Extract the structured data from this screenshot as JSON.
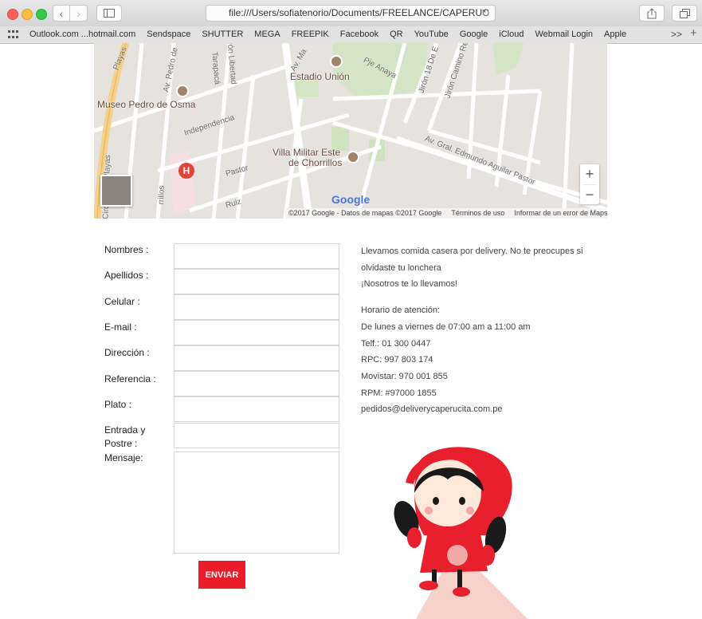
{
  "browser": {
    "address": "file:///Users/sofiatenorio/Documents/FREELANCE/CAPERUC",
    "bookmarks": [
      "Outlook.com ...hotmail.com",
      "Sendspace",
      "SHUTTER",
      "MEGA",
      "FREEPIK",
      "Facebook",
      "QR",
      "YouTube",
      "Google",
      "iCloud",
      "Webmail Login",
      "Apple"
    ],
    "more": ">>"
  },
  "map": {
    "places": {
      "museo": "Museo Pedro de Osma",
      "estadio": "Estadio Unión",
      "villa_line1": "Villa Militar Este",
      "villa_line2": "de Chorrillos"
    },
    "streets": {
      "independencia": "Independencia",
      "pastor": "Pastor",
      "ruiz": "Ruiz",
      "anaya": "Pje Anaya",
      "edmundo": "Av. Gral. Edmundo Aguilar Pastor",
      "camino": "Jirón Camino Re",
      "jiron18": "Jirón 18 De E",
      "libertad": "Jirón Libertad",
      "tarapaca": "Tarapacá",
      "pedro": "Av. Pedro de",
      "playas": "Playas",
      "circuito": "Circuito de Playas",
      "rillos": "rrillos",
      "av_ma": "Av. Ma"
    },
    "google": "Google",
    "footer": {
      "copyright": "©2017 Google - Datos de mapas ©2017 Google",
      "terms": "Términos de uso",
      "report": "Informar de un error de Maps"
    },
    "zoom_in": "+",
    "zoom_out": "−"
  },
  "form": {
    "labels": {
      "nombres": "Nombres :",
      "apellidos": "Apellidos :",
      "celular": "Celular :",
      "email": "E-mail :",
      "direccion": "Dirección :",
      "referencia": "Referencia :",
      "plato": "Plato :",
      "entrada1": "Entrada y",
      "entrada2": "Postre :",
      "mensaje": "Mensaje:"
    },
    "submit": "ENVIAR"
  },
  "info": {
    "intro1": "Llevamos comida casera por delivery. No te preocupes si",
    "intro2": "olvidaste tu lonchera",
    "intro3": "¡Nosotros te lo llevamos!",
    "horario_title": "Horario de atención:",
    "horario": "De lunes a viernes de 07:00 am a 11:00 am",
    "telf": "Telf.: 01 300 0447",
    "rpc": "RPC: 997 803 174",
    "movistar": "Movistar: 970 001 855",
    "rpm": "RPM: #97000 1855",
    "email": "pedidos@deliverycaperucita.com.pe"
  },
  "colors": {
    "accent": "#ea1c2a",
    "hood": "#e8202e"
  }
}
